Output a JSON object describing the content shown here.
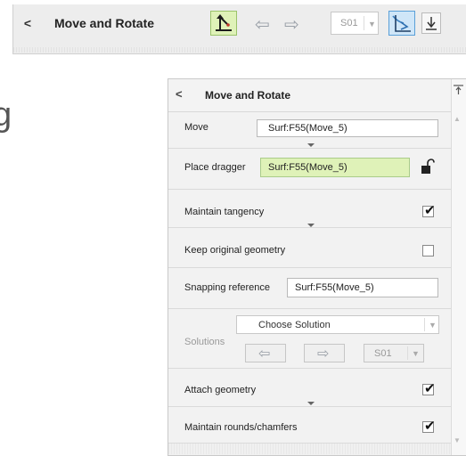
{
  "toolbar": {
    "back": "<",
    "title": "Move and Rotate",
    "left_arrow": "⇦",
    "right_arrow": "⇨",
    "solution_value": "S01",
    "dropdown": "▼"
  },
  "cut_text": "g",
  "panel": {
    "back": "<",
    "title": "Move and Rotate",
    "move_label": "Move",
    "move_value": "Surf:F55(Move_5)",
    "place_dragger_label": "Place dragger",
    "place_dragger_value": "Surf:F55(Move_5)",
    "maintain_tangency_label": "Maintain tangency",
    "maintain_tangency_checked": true,
    "keep_original_label": "Keep original geometry",
    "keep_original_checked": false,
    "snapping_label": "Snapping reference",
    "snapping_value": "Surf:F55(Move_5)",
    "solutions_label": "Solutions",
    "choose_solution": "Choose Solution",
    "solution_value": "S01",
    "attach_label": "Attach geometry",
    "attach_checked": true,
    "rounds_label": "Maintain rounds/chamfers",
    "rounds_checked": true,
    "check_mark": "✔",
    "sol_left": "⇦",
    "sol_right": "⇨",
    "dropdown": "▼"
  },
  "colors": {
    "accent_green": "#dff2b8",
    "accent_blue": "#cfe6f8"
  }
}
